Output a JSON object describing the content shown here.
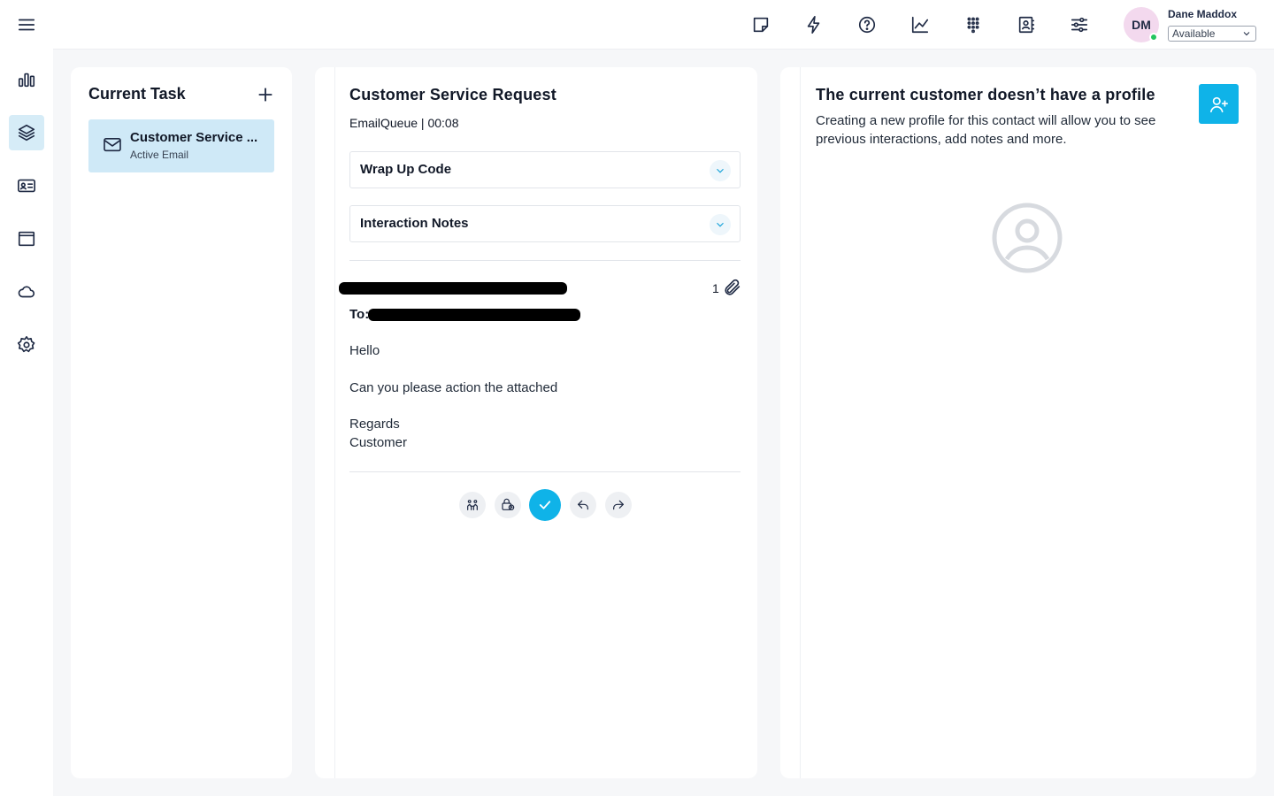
{
  "rail": {
    "items": [
      {
        "name": "menu",
        "icon": "hamburger-icon"
      },
      {
        "name": "stats",
        "icon": "bar-chart-icon"
      },
      {
        "name": "tasks",
        "icon": "layers-icon",
        "active": true
      },
      {
        "name": "contacts",
        "icon": "id-card-icon"
      },
      {
        "name": "browser",
        "icon": "window-icon"
      },
      {
        "name": "cloud",
        "icon": "cloud-icon"
      },
      {
        "name": "settings",
        "icon": "gear-icon"
      }
    ]
  },
  "topbar": {
    "icons": [
      "sticky-note-icon",
      "lightning-icon",
      "help-icon",
      "line-chart-icon",
      "dialpad-icon",
      "contact-book-icon",
      "sliders-icon"
    ],
    "user": {
      "initials": "DM",
      "name": "Dane Maddox",
      "status": "Available",
      "presence_color": "#22c55e"
    }
  },
  "tasks_panel": {
    "title": "Current Task",
    "tasks": [
      {
        "title": "Customer Service ...",
        "subtitle": "Active Email",
        "icon": "mail-icon"
      }
    ]
  },
  "interaction_panel": {
    "title": "Customer Service Request",
    "queue_info": "EmailQueue | 00:08",
    "sections": [
      {
        "label": "Wrap Up Code"
      },
      {
        "label": "Interaction Notes"
      }
    ],
    "email": {
      "to_label": "To:",
      "attachment_count": "1",
      "body_lines": [
        "Hello",
        "Can you please action the attached",
        "Regards",
        "Customer"
      ]
    },
    "actions": [
      "transfer-icon",
      "park-icon",
      "complete-icon",
      "reply-icon",
      "forward-icon"
    ],
    "accent_color": "#0fb3e8"
  },
  "profile_panel": {
    "title": "The current customer doesn’t have a profile",
    "description": "Creating a new profile for this contact will allow you to see previous interactions, add notes and more.",
    "create_button_icon": "add-user-icon",
    "placeholder_icon": "user-circle-icon"
  }
}
